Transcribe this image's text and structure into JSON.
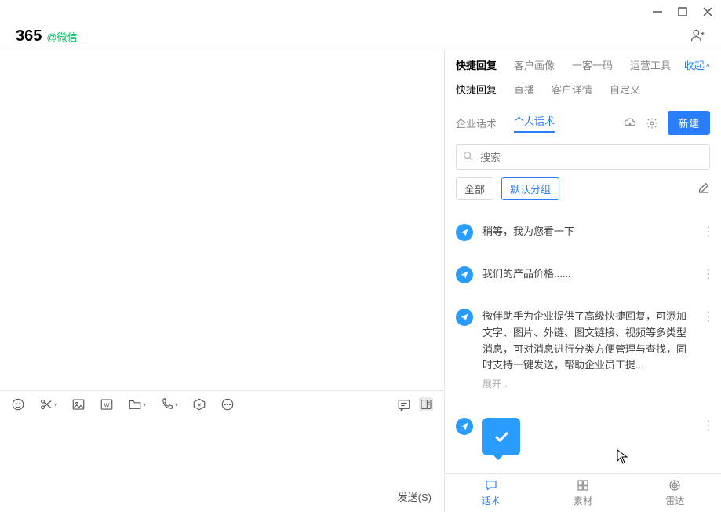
{
  "header": {
    "title": "365",
    "subtitle": "@微信"
  },
  "chat": {
    "send_label": "发送(S)"
  },
  "side": {
    "tabs": [
      "快捷回复",
      "客户画像",
      "一客一码",
      "运营工具"
    ],
    "collapse_label": "收起",
    "subtabs": [
      "快捷回复",
      "直播",
      "客户详情",
      "自定义"
    ],
    "categories": [
      "企业话术",
      "个人话术"
    ],
    "new_button": "新建",
    "search_placeholder": "搜索",
    "groups": [
      "全部",
      "默认分组"
    ],
    "replies": [
      {
        "text": "稍等，我为您看一下"
      },
      {
        "text": "我们的产品价格......"
      },
      {
        "text": "微伴助手为企业提供了高级快捷回复，可添加文字、图片、外链、图文链接、视频等多类型消息，可对消息进行分类方便管理与查找，同时支持一键发送，帮助企业员工提...",
        "expand": "展开"
      }
    ]
  },
  "bottom_nav": [
    "话术",
    "素材",
    "雷达"
  ]
}
